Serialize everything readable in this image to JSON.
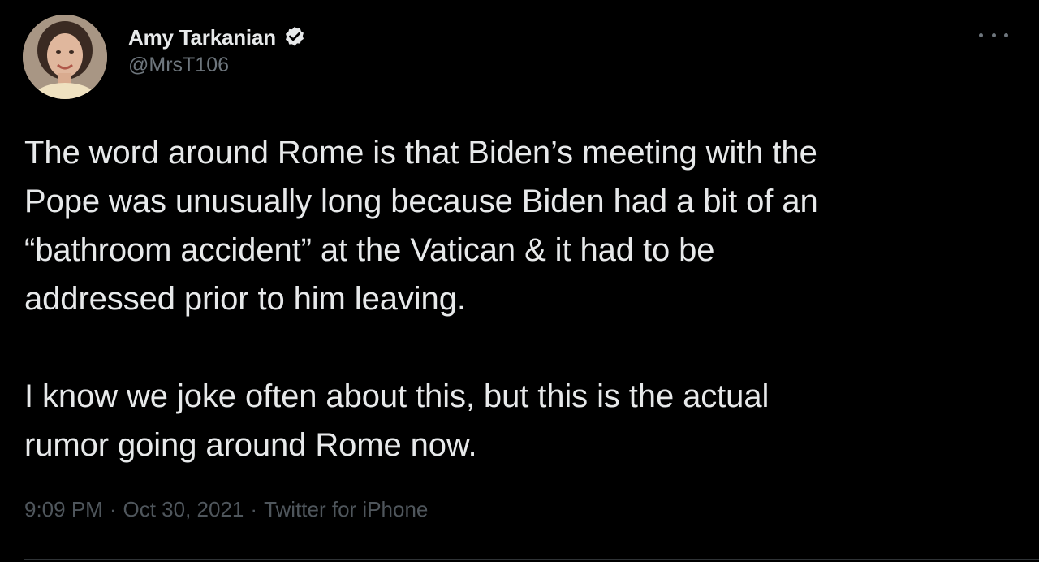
{
  "author": {
    "display_name": "Amy Tarkanian",
    "handle": "@MrsT106",
    "verified_icon": "verified-badge-icon",
    "avatar_icon": "profile-photo"
  },
  "more_icon": "more-options-icon",
  "tweet": {
    "text": "The word around Rome is that Biden’s meeting with the\nPope was unusually long because Biden had a bit of an\n“bathroom accident” at the Vatican & it had to be\naddressed prior to him leaving.\n\nI know we joke often about this, but this is the actual\nrumor going around Rome now.",
    "time": "9:09 PM",
    "separator": "·",
    "date": "Oct 30, 2021",
    "source": "Twitter for iPhone"
  },
  "colors": {
    "background": "#000000",
    "text": "#e7e9ea",
    "secondary": "#6e767d",
    "meta": "#4f565c"
  }
}
